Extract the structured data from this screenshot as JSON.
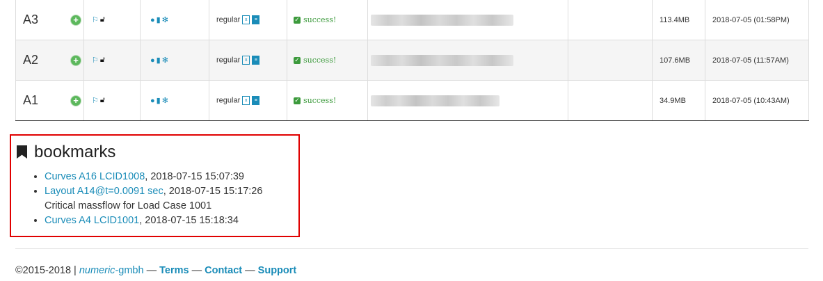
{
  "runs": [
    {
      "name": "A3",
      "type": "regular",
      "status": "success!",
      "size": "113.4MB",
      "date": "2018-07-05 (01:58PM)"
    },
    {
      "name": "A2",
      "type": "regular",
      "status": "success!",
      "size": "107.6MB",
      "date": "2018-07-05 (11:57AM)"
    },
    {
      "name": "A1",
      "type": "regular",
      "status": "success!",
      "size": "34.9MB",
      "date": "2018-07-05 (10:43AM)"
    }
  ],
  "icons": {
    "add": "plus-circle-icon",
    "flag": "flag-icon",
    "lock": "unlock-icon",
    "comment": "comment-icon",
    "delete": "trash-icon",
    "settings": "cogs-icon",
    "excel": "excel-file-icon",
    "text": "text-file-icon",
    "success": "check-square-icon"
  },
  "bookmarks": {
    "title": "bookmarks",
    "items": [
      {
        "link": "Curves A16 LCID1008",
        "suffix": ", 2018-07-15 15:07:39",
        "note": ""
      },
      {
        "link": "Layout A14@t=0.0091 sec",
        "suffix": ", 2018-07-15 15:17:26",
        "note": "Critical massflow for Load Case 1001"
      },
      {
        "link": "Curves A4 LCID1001",
        "suffix": ", 2018-07-15 15:18:34",
        "note": ""
      }
    ]
  },
  "footer": {
    "copyright": "©2015-2018 |",
    "org": "numeric",
    "org_suffix": "-gmbh",
    "dash": "—",
    "terms": "Terms",
    "contact": "Contact",
    "support": "Support"
  },
  "colors": {
    "link": "#1a8cb8",
    "success": "#3c9a3c",
    "highlight_border": "#e00000",
    "add": "#5cb85c"
  }
}
